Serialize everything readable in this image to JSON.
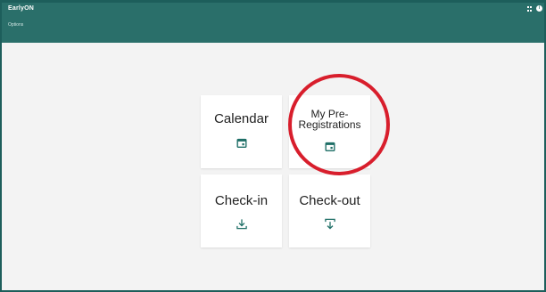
{
  "app": {
    "title": "EarlyON",
    "info_glyph": "i"
  },
  "toolbar": {
    "options_label": "Options"
  },
  "tiles": [
    {
      "label": "Calendar",
      "icon": "calendar-icon"
    },
    {
      "label_line1": "My Pre-",
      "label_line2": "Registrations",
      "icon": "calendar-icon"
    },
    {
      "label": "Check-in",
      "icon": "download-icon"
    },
    {
      "label": "Check-out",
      "icon": "upload-icon"
    }
  ],
  "annotation": {
    "highlighted_tile": "My Pre-Registrations",
    "circle_color": "#d81e2c"
  },
  "colors": {
    "header": "#2a6f6a",
    "frame": "#1d5e5b",
    "accent": "#1f6f67",
    "background": "#f3f3f3",
    "tile": "#ffffff"
  }
}
